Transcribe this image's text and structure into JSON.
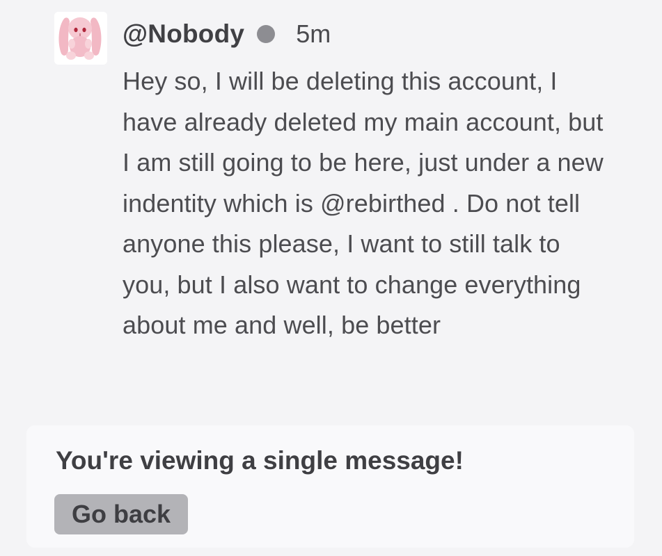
{
  "message": {
    "author": "@Nobody",
    "status": "online",
    "status_color": "#8d8d92",
    "timestamp": "5m",
    "avatar_icon": "pink-bunny-plush-avatar",
    "body": "Hey so, I will be deleting this account, I have already deleted my main account, but I am still going to be here, just under a new indentity which is @rebirthed . Do not tell anyone this please, I want to still talk to you, but I also want to change everything about me and well, be better"
  },
  "notice": {
    "title": "You're viewing a single message!",
    "back_label": "Go back"
  }
}
